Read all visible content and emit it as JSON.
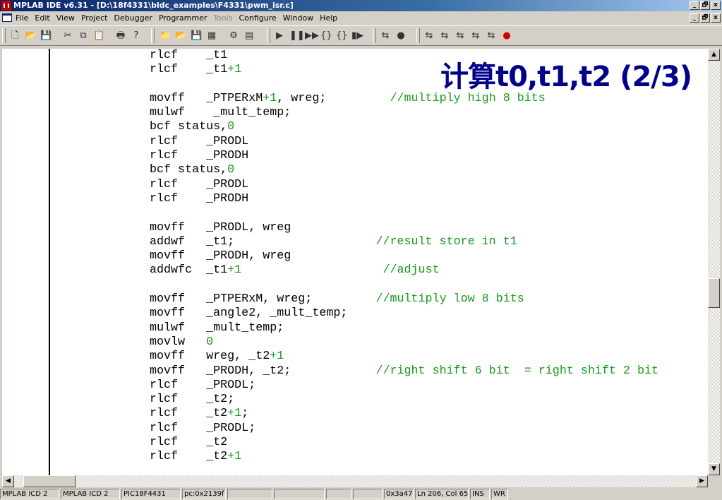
{
  "window": {
    "title": "MPLAB IDE v6.31 - [D:\\18f4331\\bldc_examples\\F4331\\pwm_isr.c]",
    "controls": [
      "_",
      "🗗",
      "x"
    ]
  },
  "menu": {
    "items": [
      {
        "label": "File",
        "enabled": true
      },
      {
        "label": "Edit",
        "enabled": true
      },
      {
        "label": "View",
        "enabled": true
      },
      {
        "label": "Project",
        "enabled": true
      },
      {
        "label": "Debugger",
        "enabled": true
      },
      {
        "label": "Programmer",
        "enabled": true
      },
      {
        "label": "Tools",
        "enabled": false
      },
      {
        "label": "Configure",
        "enabled": true
      },
      {
        "label": "Window",
        "enabled": true
      },
      {
        "label": "Help",
        "enabled": true
      }
    ],
    "mdi_controls": [
      "_",
      "🗗",
      "x"
    ]
  },
  "toolbar": {
    "icons": [
      "new-file-icon",
      "open-file-icon",
      "save-icon",
      "cut-icon",
      "copy-icon",
      "paste-icon",
      "print-icon",
      "help-icon",
      "new-project-icon",
      "open-project-icon",
      "save-project-icon",
      "build-icon",
      "make-icon",
      "build-all-icon",
      "run-icon",
      "halt-icon",
      "animate-icon",
      "step-into-icon",
      "step-over-icon",
      "reset-icon",
      "debugger-icon-1",
      "debugger-icon-2",
      "programmer-icon-1",
      "programmer-icon-2",
      "programmer-icon-3",
      "programmer-icon-4",
      "programmer-icon-5",
      "programmer-icon-6"
    ]
  },
  "overlay_title": "计算t0,t1,t2 (2/3)",
  "code_lines": [
    [
      {
        "t": "rlcf    _t1"
      }
    ],
    [
      {
        "t": "rlcf    _t1"
      },
      {
        "t": "+1",
        "c": "num"
      }
    ],
    [
      {
        "t": ""
      }
    ],
    [
      {
        "t": "movff   _PTPERxM"
      },
      {
        "t": "+1",
        "c": "num"
      },
      {
        "t": ", wreg;         "
      },
      {
        "t": "//multiply high 8 bits",
        "c": "cmt"
      }
    ],
    [
      {
        "t": "mulwf    _mult_temp;"
      }
    ],
    [
      {
        "t": "bcf status,"
      },
      {
        "t": "0",
        "c": "num"
      }
    ],
    [
      {
        "t": "rlcf    _PRODL"
      }
    ],
    [
      {
        "t": "rlcf    _PRODH"
      }
    ],
    [
      {
        "t": "bcf status,"
      },
      {
        "t": "0",
        "c": "num"
      }
    ],
    [
      {
        "t": "rlcf    _PRODL"
      }
    ],
    [
      {
        "t": "rlcf    _PRODH"
      }
    ],
    [
      {
        "t": ""
      }
    ],
    [
      {
        "t": "movff   _PRODL, wreg"
      }
    ],
    [
      {
        "t": "addwf   _t1;                    "
      },
      {
        "t": "//result store in t1",
        "c": "cmt"
      }
    ],
    [
      {
        "t": "movff   _PRODH, wreg"
      }
    ],
    [
      {
        "t": "addwfc  _t1"
      },
      {
        "t": "+1",
        "c": "num"
      },
      {
        "t": "                    "
      },
      {
        "t": "//adjust",
        "c": "cmt"
      }
    ],
    [
      {
        "t": ""
      }
    ],
    [
      {
        "t": "movff   _PTPERxM, wreg;         "
      },
      {
        "t": "//multiply low 8 bits",
        "c": "cmt"
      }
    ],
    [
      {
        "t": "movff   _angle2, _mult_temp;"
      }
    ],
    [
      {
        "t": "mulwf   _mult_temp;"
      }
    ],
    [
      {
        "t": "movlw   "
      },
      {
        "t": "0",
        "c": "num"
      }
    ],
    [
      {
        "t": "movff   wreg, _t2"
      },
      {
        "t": "+1",
        "c": "num"
      }
    ],
    [
      {
        "t": "movff   _PRODH, _t2;            "
      },
      {
        "t": "//right shift 6 bit  = right shift 2 bit",
        "c": "cmt"
      }
    ],
    [
      {
        "t": "rlcf    _PRODL;"
      }
    ],
    [
      {
        "t": "rlcf    _t2;"
      }
    ],
    [
      {
        "t": "rlcf    _t2"
      },
      {
        "t": "+1",
        "c": "num"
      },
      {
        "t": ";"
      }
    ],
    [
      {
        "t": "rlcf    _PRODL;"
      }
    ],
    [
      {
        "t": "rlcf    _t2"
      }
    ],
    [
      {
        "t": "rlcf    _t2"
      },
      {
        "t": "+1",
        "c": "num"
      }
    ]
  ],
  "status_bar": [
    "MPLAB ICD 2",
    "MPLAB ICD 2",
    "PIC18F4431",
    "pc:0x2139f",
    "",
    "",
    "",
    "",
    "0x3a47",
    "Ln 206, Col 65",
    "INS",
    "WR"
  ]
}
